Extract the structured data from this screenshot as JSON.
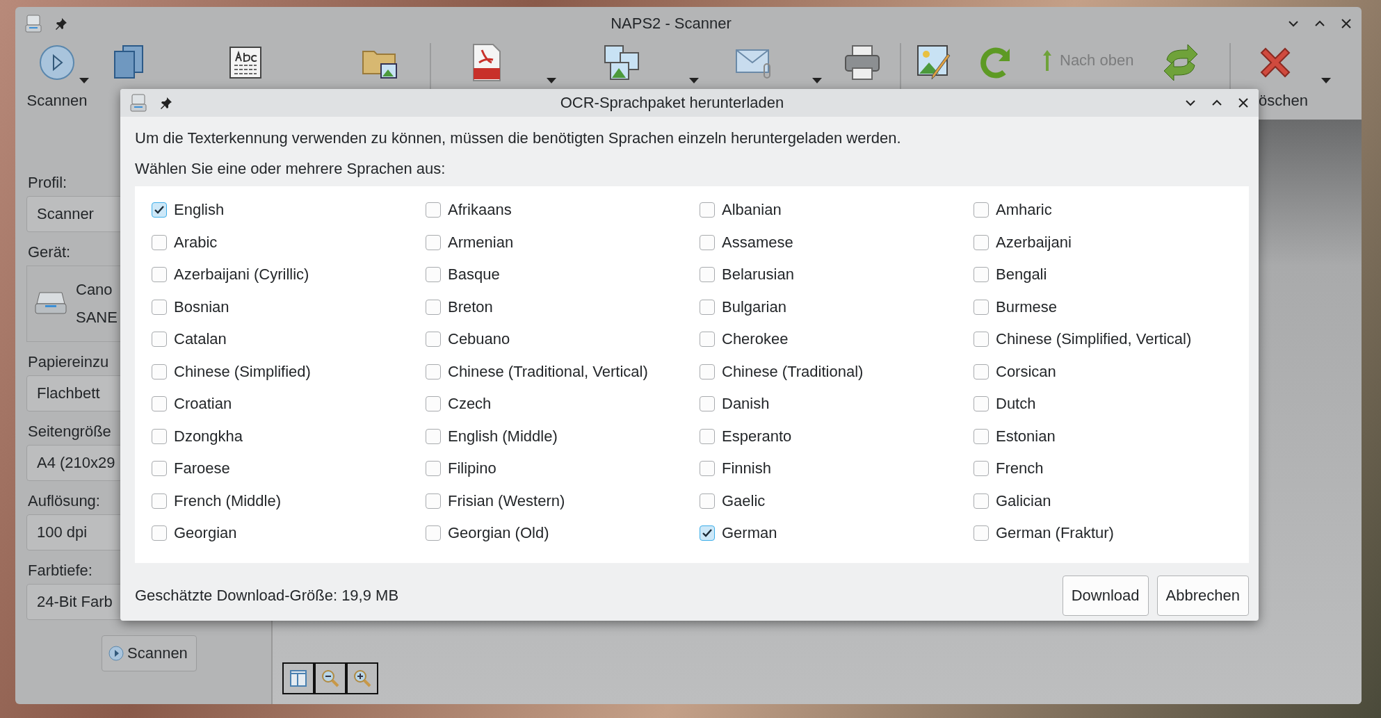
{
  "window": {
    "title": "NAPS2 - Scanner"
  },
  "toolbar": {
    "scan_label": "Scannen",
    "move_up_label": "Nach oben",
    "delete_label": "öschen"
  },
  "settings": [
    {
      "kind": "field",
      "label": "Profil:",
      "value": "Scanner"
    },
    {
      "kind": "device",
      "label": "Gerät:",
      "lines": [
        "Cano",
        "SANE"
      ]
    },
    {
      "kind": "field",
      "label": "Papiereinzu",
      "value": "Flachbett"
    },
    {
      "kind": "field",
      "label": "Seitengröße",
      "value": "A4 (210x29"
    },
    {
      "kind": "field",
      "label": "Auflösung:",
      "value": "100 dpi"
    },
    {
      "kind": "field",
      "label": "Farbtiefe:",
      "value": "24-Bit Farb"
    }
  ],
  "scan_button": "Scannen",
  "dialog": {
    "title": "OCR-Sprachpaket herunterladen",
    "intro": "Um die Texterkennung verwenden zu können, müssen die benötigten Sprachen einzeln heruntergeladen werden.",
    "prompt": "Wählen Sie eine oder mehrere Sprachen aus:",
    "languages": [
      {
        "name": "English",
        "checked": true
      },
      {
        "name": "Afrikaans",
        "checked": false
      },
      {
        "name": "Albanian",
        "checked": false
      },
      {
        "name": "Amharic",
        "checked": false
      },
      {
        "name": "Arabic",
        "checked": false
      },
      {
        "name": "Armenian",
        "checked": false
      },
      {
        "name": "Assamese",
        "checked": false
      },
      {
        "name": "Azerbaijani",
        "checked": false
      },
      {
        "name": "Azerbaijani (Cyrillic)",
        "checked": false
      },
      {
        "name": "Basque",
        "checked": false
      },
      {
        "name": "Belarusian",
        "checked": false
      },
      {
        "name": "Bengali",
        "checked": false
      },
      {
        "name": "Bosnian",
        "checked": false
      },
      {
        "name": "Breton",
        "checked": false
      },
      {
        "name": "Bulgarian",
        "checked": false
      },
      {
        "name": "Burmese",
        "checked": false
      },
      {
        "name": "Catalan",
        "checked": false
      },
      {
        "name": "Cebuano",
        "checked": false
      },
      {
        "name": "Cherokee",
        "checked": false
      },
      {
        "name": "Chinese (Simplified, Vertical)",
        "checked": false
      },
      {
        "name": "Chinese (Simplified)",
        "checked": false
      },
      {
        "name": "Chinese (Traditional, Vertical)",
        "checked": false
      },
      {
        "name": "Chinese (Traditional)",
        "checked": false
      },
      {
        "name": "Corsican",
        "checked": false
      },
      {
        "name": "Croatian",
        "checked": false
      },
      {
        "name": "Czech",
        "checked": false
      },
      {
        "name": "Danish",
        "checked": false
      },
      {
        "name": "Dutch",
        "checked": false
      },
      {
        "name": "Dzongkha",
        "checked": false
      },
      {
        "name": "English (Middle)",
        "checked": false
      },
      {
        "name": "Esperanto",
        "checked": false
      },
      {
        "name": "Estonian",
        "checked": false
      },
      {
        "name": "Faroese",
        "checked": false
      },
      {
        "name": "Filipino",
        "checked": false
      },
      {
        "name": "Finnish",
        "checked": false
      },
      {
        "name": "French",
        "checked": false
      },
      {
        "name": "French (Middle)",
        "checked": false
      },
      {
        "name": "Frisian (Western)",
        "checked": false
      },
      {
        "name": "Gaelic",
        "checked": false
      },
      {
        "name": "Galician",
        "checked": false
      },
      {
        "name": "Georgian",
        "checked": false
      },
      {
        "name": "Georgian (Old)",
        "checked": false
      },
      {
        "name": "German",
        "checked": true
      },
      {
        "name": "German (Fraktur)",
        "checked": false
      }
    ],
    "size_text": "Geschätzte Download-Größe: 19,9 MB",
    "buttons": [
      "Download",
      "Abbrechen"
    ]
  }
}
